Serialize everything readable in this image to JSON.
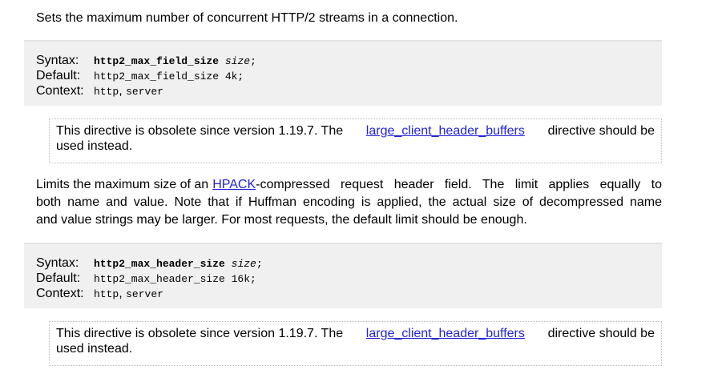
{
  "intro": "Sets the maximum number of concurrent HTTP/2 streams in a connection.",
  "directive1": {
    "syntax_label": "Syntax:",
    "syntax_name": "http2_max_field_size",
    "syntax_arg": "size",
    "syntax_end": ";",
    "default_label": "Default:",
    "default_value": "http2_max_field_size 4k;",
    "context_label": "Context:",
    "context_http": "http",
    "context_sep": ", ",
    "context_server": "server",
    "note_pre": "This directive is obsolete since version 1.19.7. The",
    "note_link": "large_client_header_buffers",
    "note_post": "directive should be",
    "note_line2": "used instead."
  },
  "description": {
    "line1_pre": "Limits the maximum size of an",
    "line1_link": "HPACK",
    "line1_post": "-compressed request header field. The limit applies equally to",
    "line2": "both name and value. Note that if Huffman encoding is applied, the actual size of decompressed name",
    "line3": "and value strings may be larger. For most requests, the default limit should be enough."
  },
  "directive2": {
    "syntax_label": "Syntax:",
    "syntax_name": "http2_max_header_size",
    "syntax_arg": "size",
    "syntax_end": ";",
    "default_label": "Default:",
    "default_value": "http2_max_header_size 16k;",
    "context_label": "Context:",
    "context_http": "http",
    "context_sep": ", ",
    "context_server": "server",
    "note_pre": "This directive is obsolete since version 1.19.7. The",
    "note_link": "large_client_header_buffers",
    "note_post": "directive should be",
    "note_line2": "used instead."
  },
  "colors": {
    "link": "#2323d6",
    "box_bg": "#f0f0f0",
    "note_border": "#bcbcbc"
  }
}
